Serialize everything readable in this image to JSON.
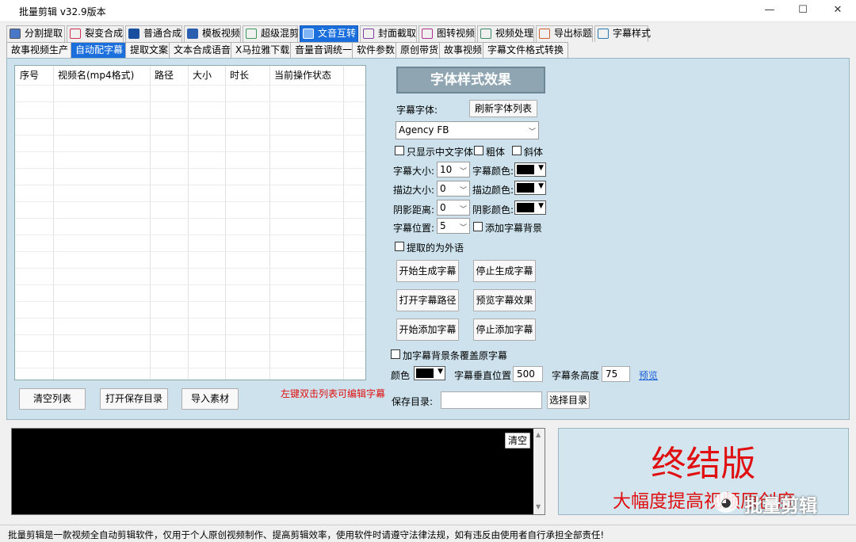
{
  "window": {
    "title": "批量剪辑   v32.9版本",
    "min_icon": "minimize-icon",
    "max_icon": "maximize-icon",
    "close_icon": "close-icon"
  },
  "main_tabs": [
    {
      "label": "分割提取",
      "selected": false
    },
    {
      "label": "裂变合成",
      "selected": false
    },
    {
      "label": "普通合成",
      "selected": false
    },
    {
      "label": "模板视频",
      "selected": false
    },
    {
      "label": "超级混剪",
      "selected": false
    },
    {
      "label": "文音互转",
      "selected": true
    },
    {
      "label": "封面截取",
      "selected": false
    },
    {
      "label": "图转视频",
      "selected": false
    },
    {
      "label": "视频处理",
      "selected": false
    },
    {
      "label": "导出标题",
      "selected": false
    },
    {
      "label": "字幕样式",
      "selected": false
    }
  ],
  "sub_tabs": [
    {
      "label": "故事视频生产",
      "selected": false
    },
    {
      "label": "自动配字幕",
      "selected": true
    },
    {
      "label": "提取文案",
      "selected": false
    },
    {
      "label": "文本合成语音",
      "selected": false
    },
    {
      "label": "X马拉雅下载",
      "selected": false
    },
    {
      "label": "音量音调统一",
      "selected": false
    },
    {
      "label": "软件参数",
      "selected": false
    },
    {
      "label": "原创带货",
      "selected": false
    },
    {
      "label": "故事视频",
      "selected": false
    },
    {
      "label": "字幕文件格式转换",
      "selected": false
    }
  ],
  "table": {
    "columns": [
      "序号",
      "视频名(mp4格式)",
      "路径",
      "大小",
      "时长",
      "当前操作状态"
    ],
    "rows": []
  },
  "left_buttons": {
    "clear": "清空列表",
    "open_save": "打开保存目录",
    "import": "导入素材"
  },
  "hint": "左键双击列表可编辑字幕",
  "style_panel": {
    "header": "字体样式效果",
    "font_label": "字幕字体:",
    "refresh_button": "刷新字体列表",
    "font_value": "Agency FB",
    "only_chinese": "只显示中文字体",
    "bold": "粗体",
    "italic": "斜体",
    "size_label": "字幕大小:",
    "size_value": "10",
    "color_label": "字幕颜色:",
    "color_value": "#000000",
    "outline_size_label": "描边大小:",
    "outline_size_value": "0",
    "outline_color_label": "描边颜色:",
    "outline_color_value": "#000000",
    "shadow_label": "阴影距离:",
    "shadow_value": "0",
    "shadow_color_label": "阴影颜色:",
    "shadow_color_value": "#000000",
    "position_label": "字幕位置:",
    "position_value": "5",
    "add_bg": "添加字幕背景",
    "foreign": "提取的为外语"
  },
  "action_buttons": {
    "start_gen": "开始生成字幕",
    "stop_gen": "停止生成字幕",
    "open_path": "打开字幕路径",
    "preview_effect": "预览字幕效果",
    "start_add": "开始添加字幕",
    "stop_add": "停止添加字幕"
  },
  "bg_options": {
    "cover_label": "加字幕背景条覆盖原字幕",
    "color_label": "颜色",
    "color_value": "#000000",
    "vpos_label": "字幕垂直位置",
    "vpos_value": "500",
    "height_label": "字幕条高度",
    "height_value": "75",
    "preview_link": "预览"
  },
  "save": {
    "label": "保存目录:",
    "value": "",
    "choose_button": "选择目录"
  },
  "log": {
    "clear_button": "清空"
  },
  "promo": {
    "title": "终结版",
    "subtitle": "大幅度提高视频原创度",
    "watermark": "批量剪辑"
  },
  "status": "批量剪辑是一款视频全自动剪辑软件，仅用于个人原创视频制作、提高剪辑效率，使用软件时请遵守法律法规，如有违反由使用者自行承担全部责任!",
  "colors": {
    "accent": "#1a6fdc",
    "panel": "#cde2ec",
    "promo_text": "#e01010"
  }
}
